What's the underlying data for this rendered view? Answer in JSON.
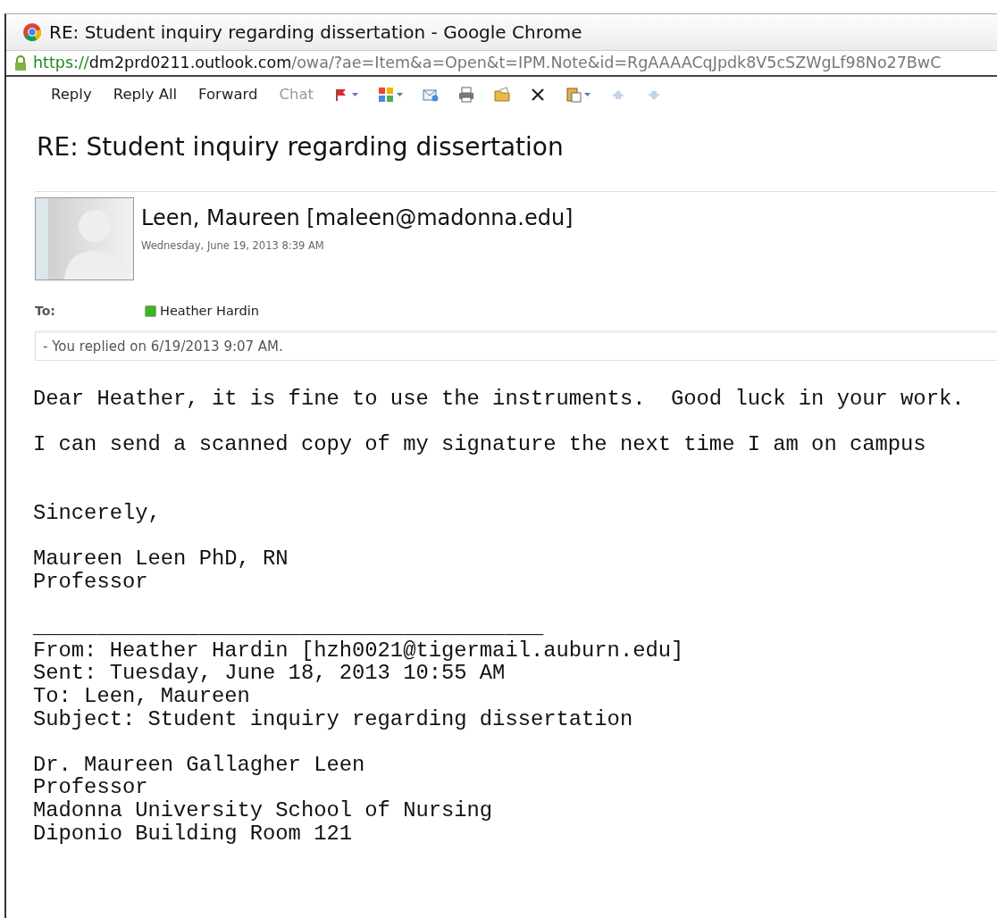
{
  "window": {
    "title": "RE: Student inquiry regarding dissertation - Google Chrome"
  },
  "address_bar": {
    "scheme": "https://",
    "host": "dm2prd0211.outlook.com",
    "path": "/owa/?ae=Item&a=Open&t=IPM.Note&id=RgAAAACqJpdk8V5cSZWgLf98No27BwC"
  },
  "toolbar": [
    {
      "kind": "text",
      "label": "Reply",
      "disabled": false
    },
    {
      "kind": "text",
      "label": "Reply All",
      "disabled": false
    },
    {
      "kind": "text",
      "label": "Forward",
      "disabled": false
    },
    {
      "kind": "text",
      "label": "Chat",
      "disabled": true
    },
    {
      "kind": "flag",
      "dropdown": true,
      "disabled": false
    },
    {
      "kind": "categories",
      "dropdown": true,
      "disabled": false
    },
    {
      "kind": "move",
      "dropdown": false,
      "disabled": false
    },
    {
      "kind": "print",
      "dropdown": false,
      "disabled": false
    },
    {
      "kind": "folder",
      "dropdown": false,
      "disabled": false
    },
    {
      "kind": "delete",
      "dropdown": false,
      "disabled": false
    },
    {
      "kind": "paste",
      "dropdown": true,
      "disabled": false
    },
    {
      "kind": "up",
      "dropdown": false,
      "disabled": true
    },
    {
      "kind": "down",
      "dropdown": false,
      "disabled": true
    }
  ],
  "message": {
    "subject": "RE: Student inquiry regarding dissertation",
    "sender": "Leen, Maureen [maleen@madonna.edu]",
    "date": "Wednesday, June 19, 2013 8:39 AM",
    "to_label": "To:",
    "recipients": [
      {
        "name": "Heather Hardin",
        "color": "#3cb424"
      }
    ],
    "info_bar": "- You replied on 6/19/2013 9:07 AM.",
    "body": [
      {
        "extra_gap_before": false,
        "lines": [
          "Dear Heather, it is fine to use the instruments.  Good luck in your work."
        ]
      },
      {
        "extra_gap_before": false,
        "lines": [
          "I can send a scanned copy of my signature the next time I am on campus"
        ]
      },
      {
        "extra_gap_before": true,
        "lines": [
          "Sincerely,"
        ]
      },
      {
        "extra_gap_before": false,
        "lines": [
          "Maureen Leen PhD, RN",
          "Professor"
        ]
      },
      {
        "extra_gap_before": false,
        "lines": [
          "________________________________________",
          "From: Heather Hardin [hzh0021@tigermail.auburn.edu]",
          "Sent: Tuesday, June 18, 2013 10:55 AM",
          "To: Leen, Maureen",
          "Subject: Student inquiry regarding dissertation"
        ]
      },
      {
        "extra_gap_before": false,
        "lines": [
          "Dr. Maureen Gallagher Leen",
          "Professor",
          "Madonna University School of Nursing",
          "Diponio Building Room 121"
        ]
      }
    ]
  }
}
